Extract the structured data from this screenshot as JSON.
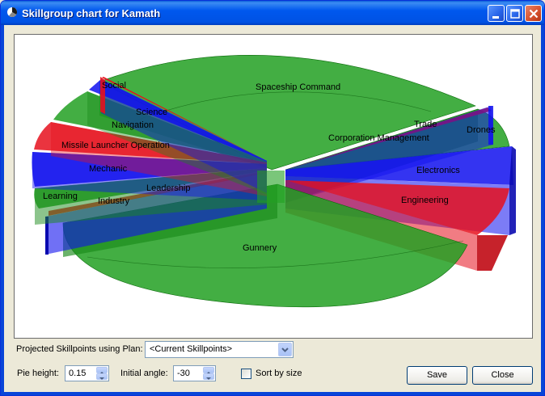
{
  "window": {
    "title": "Skillgroup chart for Kamath"
  },
  "chart_data": {
    "type": "pie",
    "style": "3d-exploded",
    "slices": [
      {
        "label": "Spaceship Command",
        "color": "#22a022"
      },
      {
        "label": "Corporation Management",
        "color": "#22a022"
      },
      {
        "label": "Trade",
        "color": "#e6111d"
      },
      {
        "label": "Drones",
        "color": "#1010ee"
      },
      {
        "label": "Electronics",
        "color": "#1010ee"
      },
      {
        "label": "Engineering",
        "color": "#e6111d"
      },
      {
        "label": "Gunnery",
        "color": "#22a022"
      },
      {
        "label": "Industry",
        "color": "#1010ee"
      },
      {
        "label": "Leadership",
        "color": "#22a022"
      },
      {
        "label": "Learning",
        "color": "#22a022"
      },
      {
        "label": "Mechanic",
        "color": "#1010ee"
      },
      {
        "label": "Missile Launcher Operation",
        "color": "#e6111d"
      },
      {
        "label": "Navigation",
        "color": "#22a022"
      },
      {
        "label": "Science",
        "color": "#1010ee"
      },
      {
        "label": "Social",
        "color": "#e6111d"
      }
    ]
  },
  "plan": {
    "label": "Projected Skillpoints using Plan:",
    "selected": "<Current Skillpoints>"
  },
  "settings": {
    "pie_height_label": "Pie height:",
    "pie_height_value": "0.15",
    "initial_angle_label": "Initial angle:",
    "initial_angle_value": "-30",
    "sort_by_size_label": "Sort by size",
    "sort_by_size_checked": false
  },
  "buttons": {
    "save": "Save",
    "close": "Close"
  },
  "colors": {
    "green": "#22a022",
    "red": "#e6111d",
    "blue": "#1010ee",
    "titlebar": "#0058ee"
  }
}
